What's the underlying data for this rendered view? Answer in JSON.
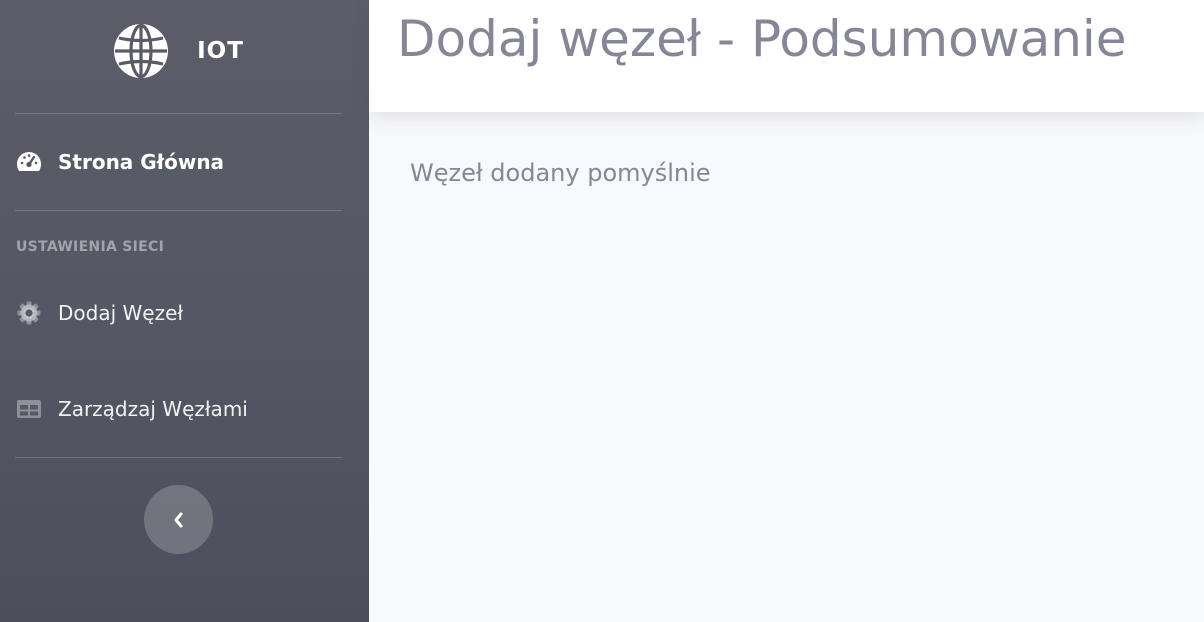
{
  "brand": {
    "name": "IOT",
    "icon": "globe-icon"
  },
  "sidebar": {
    "dashboard": {
      "label": "Strona Główna",
      "icon": "tachometer-icon"
    },
    "section_heading": "USTAWIENIA SIECI",
    "items": [
      {
        "label": "Dodaj Węzeł",
        "icon": "cog-icon"
      },
      {
        "label": "Zarządzaj Węzłami",
        "icon": "table-icon"
      }
    ],
    "toggle": {
      "icon": "chevron-left-icon"
    }
  },
  "header": {
    "title": "Dodaj węzeł - Podsumowanie"
  },
  "main": {
    "message": "Węzeł dodany pomyślnie"
  },
  "colors": {
    "sidebar": "#575866",
    "text_muted": "#858796",
    "content_bg": "#f8f9fc"
  }
}
